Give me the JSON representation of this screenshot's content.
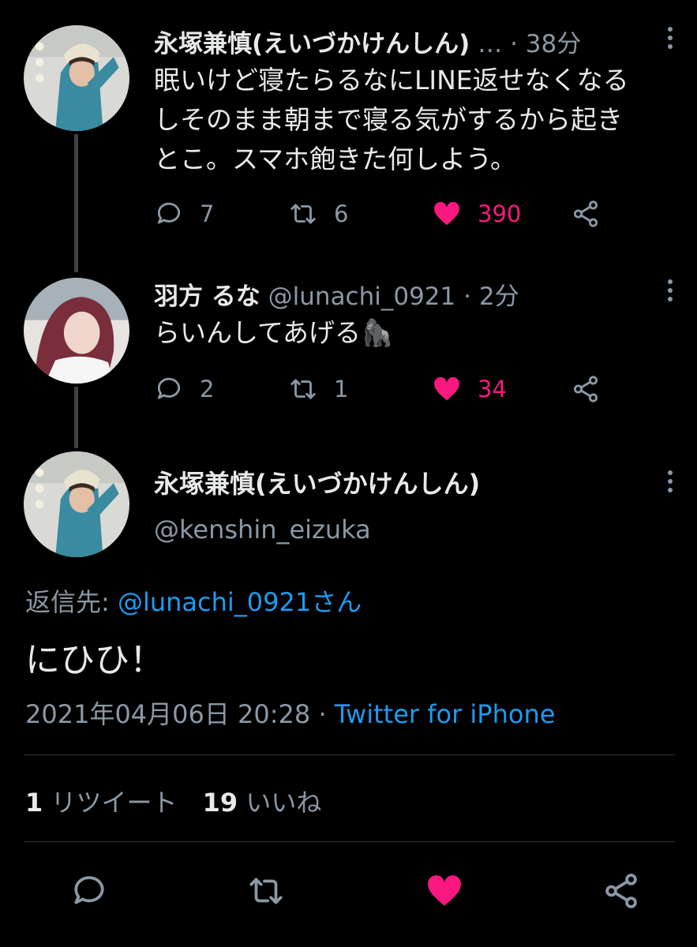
{
  "tweet1": {
    "display_name": "永塚兼慎(えいづかけんしん)",
    "ellipsis": "…",
    "separator": "·",
    "time": "38分",
    "text_lines": [
      "眠いけど寝たらるなにLINE返せなくなる",
      "しそのまま朝まで寝る気がするから起き",
      "とこ。スマホ飽きた何しよう。"
    ],
    "replies": "7",
    "retweets": "6",
    "likes": "390"
  },
  "tweet2": {
    "display_name": "羽方 るな",
    "handle": "@lunachi_0921",
    "separator": "·",
    "time": "2分",
    "text": "らいんしてあげる🦍",
    "replies": "2",
    "retweets": "1",
    "likes": "34"
  },
  "main": {
    "display_name": "永塚兼慎(えいづかけんしん)",
    "handle": "@kenshin_eizuka",
    "reply_to_label": "返信先:",
    "reply_to_user": "@lunachi_0921さん",
    "text": "にひひ！",
    "timestamp": "2021年04月06日 20:28",
    "separator": "·",
    "source": "Twitter for iPhone",
    "retweet_count": "1",
    "retweet_label": "リツイート",
    "like_count": "19",
    "like_label": "いいね"
  },
  "icons": {
    "reply": "reply-icon",
    "retweet": "retweet-icon",
    "like": "heart-icon",
    "share": "share-icon",
    "more": "more-vertical-icon"
  },
  "colors": {
    "background": "#000000",
    "text": "#e7e9ea",
    "muted": "#8b98a5",
    "link": "#1d9bf0",
    "like": "#f91880"
  }
}
